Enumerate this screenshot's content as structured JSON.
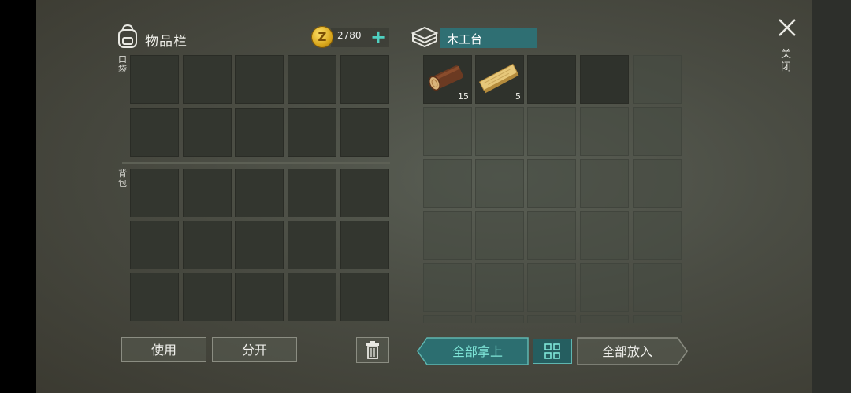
{
  "inventory": {
    "title": "物品栏",
    "pocket_label": "口袋",
    "backpack_label": "背包",
    "coins": "2780",
    "plus_symbol": "+"
  },
  "container": {
    "title": "木工台",
    "items": [
      {
        "name": "log-icon",
        "qty": "15"
      },
      {
        "name": "plank-icon",
        "qty": "5"
      }
    ]
  },
  "close": {
    "symbol": "✕",
    "label": "关闭"
  },
  "buttons": {
    "use": "使用",
    "split": "分开",
    "take_all": "全部拿上",
    "put_all": "全部放入"
  },
  "colors": {
    "accent": "#2f6f73",
    "accent_text": "#4fd0c0",
    "coin": "#d7a419"
  }
}
